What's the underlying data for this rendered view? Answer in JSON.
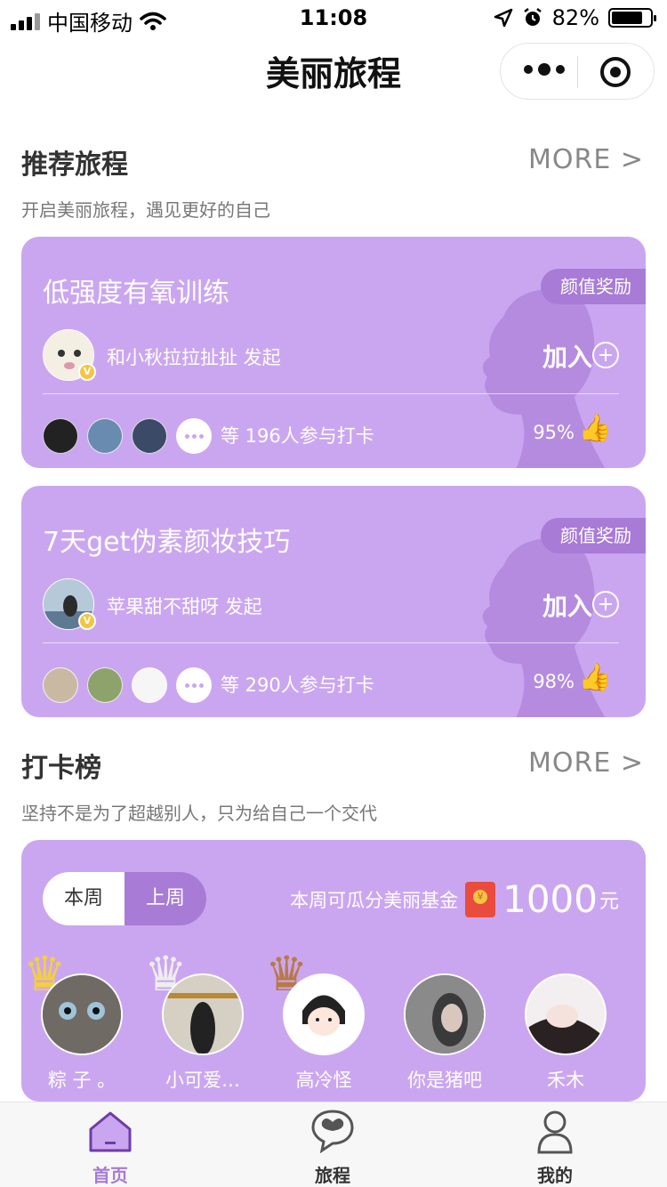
{
  "status_bar": {
    "carrier": "中国移动",
    "time": "11:08",
    "battery": "82%",
    "battery_level": 0.82
  },
  "nav": {
    "title": "美丽旅程"
  },
  "recommend": {
    "title": "推荐旅程",
    "more": "MORE >",
    "subtitle": "开启美丽旅程，遇见更好的自己"
  },
  "journeys": [
    {
      "title": "低强度有氧训练",
      "badge": "颜值奖励",
      "creator": "和小秋拉拉扯扯 发起",
      "join": "加入",
      "participants": "等 196人参与打卡",
      "rate": "95%"
    },
    {
      "title": "7天get伪素颜妆技巧",
      "badge": "颜值奖励",
      "creator": "苹果甜不甜呀 发起",
      "join": "加入",
      "participants": "等 290人参与打卡",
      "rate": "98%"
    }
  ],
  "ranking": {
    "title": "打卡榜",
    "more": "MORE >",
    "subtitle": "坚持不是为了超越别人，只为给自己一个交代",
    "tabs": [
      "本周",
      "上周"
    ],
    "fund_text": "本周可瓜分美丽基金",
    "fund_amount": "1000",
    "fund_unit": "元",
    "users": [
      "粽 子 。",
      "小可爱…",
      "高冷怪",
      "你是猪吧",
      "禾木"
    ]
  },
  "tabbar": {
    "items": [
      "首页",
      "旅程",
      "我的"
    ],
    "active_color": "#a77bd6"
  },
  "colors": {
    "card": "#cba6f0",
    "accent": "#a77bd6"
  }
}
